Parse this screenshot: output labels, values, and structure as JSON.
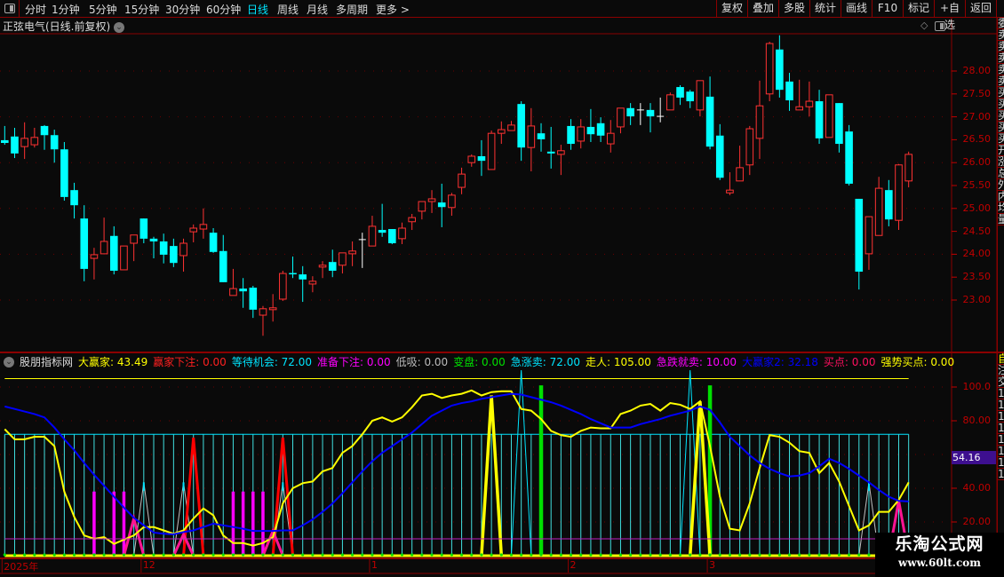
{
  "topbar": {
    "tabs": [
      "分时",
      "1分钟",
      "5分钟",
      "15分钟",
      "30分钟",
      "60分钟",
      "日线",
      "周线",
      "月线",
      "多周期",
      "更多 >"
    ],
    "active_tab": "日线",
    "right_buttons": [
      "复权",
      "叠加",
      "多股",
      "统计",
      "画线",
      "F10",
      "标记",
      "+自选",
      "返回"
    ]
  },
  "title": "正弦电气(日线.前复权)",
  "price_axis": {
    "labels": [
      "28.00",
      "27.50",
      "27.00",
      "26.50",
      "26.00",
      "25.50",
      "25.00",
      "24.50",
      "24.00",
      "23.50",
      "23.00"
    ],
    "range": [
      22.0,
      29.0
    ]
  },
  "right_strip": {
    "top": [
      "委",
      "卖",
      "卖",
      "卖",
      "卖",
      "卖",
      "买",
      "买",
      "买",
      "买",
      "买",
      "开",
      "涨",
      "总",
      "外",
      "内",
      "均",
      "量"
    ],
    "bottom": [
      "自",
      "注",
      "交",
      "1",
      "1",
      "1",
      "1",
      "1",
      "1",
      "1",
      "1"
    ]
  },
  "colors": {
    "up": "#ff3232",
    "down": "#00ffff",
    "doji": "#ffffff",
    "yellow": "#ffff00",
    "blue": "#0000ff",
    "magenta": "#ff00ff",
    "green": "#00e000",
    "pink": "#ff1493",
    "red": "#ff0000"
  },
  "candles": [
    [
      26.49,
      26.43,
      26.8,
      26.39
    ],
    [
      26.57,
      26.2,
      26.76,
      26.1
    ],
    [
      26.35,
      26.53,
      26.88,
      26.08
    ],
    [
      26.39,
      26.55,
      26.76,
      26.33
    ],
    [
      26.8,
      26.6,
      26.82,
      26.28
    ],
    [
      26.6,
      26.29,
      26.72,
      26.0
    ],
    [
      26.29,
      25.25,
      26.45,
      25.17
    ],
    [
      25.4,
      25.07,
      25.56,
      24.78
    ],
    [
      24.78,
      23.68,
      25.07,
      23.41
    ],
    [
      23.91,
      23.99,
      24.14,
      23.45
    ],
    [
      24.01,
      24.28,
      24.8,
      24.0
    ],
    [
      24.4,
      23.64,
      24.61,
      23.56
    ],
    [
      23.66,
      24.18,
      24.18,
      23.66
    ],
    [
      24.24,
      24.42,
      24.42,
      23.85
    ],
    [
      24.78,
      24.34,
      24.78,
      24.24
    ],
    [
      24.34,
      24.28,
      24.38,
      23.91
    ],
    [
      24.28,
      23.99,
      24.45,
      23.8
    ],
    [
      24.18,
      23.81,
      24.34,
      23.72
    ],
    [
      23.97,
      24.24,
      24.34,
      23.62
    ],
    [
      24.49,
      24.57,
      24.65,
      24.26
    ],
    [
      24.55,
      24.65,
      25.0,
      24.34
    ],
    [
      24.47,
      24.05,
      24.57,
      24.03
    ],
    [
      24.07,
      23.39,
      24.42,
      23.39
    ],
    [
      23.1,
      23.25,
      23.68,
      23.1
    ],
    [
      23.25,
      23.19,
      23.48,
      22.83
    ],
    [
      23.27,
      22.79,
      23.31,
      22.61
    ],
    [
      22.67,
      22.81,
      22.87,
      22.22
    ],
    [
      22.79,
      22.83,
      23.13,
      22.53
    ],
    [
      23.02,
      23.58,
      23.64,
      22.98
    ],
    [
      23.59,
      23.57,
      23.95,
      23.48
    ],
    [
      23.56,
      23.45,
      23.74,
      22.96
    ],
    [
      23.35,
      23.41,
      23.52,
      23.17
    ],
    [
      23.72,
      23.76,
      23.85,
      23.48
    ],
    [
      23.83,
      23.64,
      24.1,
      23.5
    ],
    [
      23.76,
      24.03,
      24.03,
      23.58
    ],
    [
      24.01,
      24.07,
      24.28,
      23.74
    ],
    [
      24.32,
      24.32,
      24.47,
      23.7
    ],
    [
      24.18,
      24.61,
      24.84,
      24.18
    ],
    [
      24.53,
      24.47,
      25.1,
      24.38
    ],
    [
      24.55,
      24.24,
      24.55,
      24.22
    ],
    [
      24.34,
      24.57,
      24.69,
      24.22
    ],
    [
      24.71,
      24.8,
      24.88,
      24.53
    ],
    [
      24.94,
      25.15,
      25.15,
      24.76
    ],
    [
      25.15,
      25.21,
      25.4,
      24.9
    ],
    [
      25.13,
      25.03,
      25.54,
      24.59
    ],
    [
      25.02,
      25.29,
      25.34,
      24.84
    ],
    [
      25.46,
      25.75,
      25.89,
      25.31
    ],
    [
      26.0,
      26.14,
      26.18,
      25.91
    ],
    [
      26.14,
      26.04,
      26.49,
      25.71
    ],
    [
      25.85,
      26.64,
      26.7,
      25.85
    ],
    [
      26.64,
      26.72,
      26.9,
      26.41
    ],
    [
      26.7,
      26.82,
      26.91,
      26.7
    ],
    [
      27.28,
      26.33,
      27.34,
      26.04
    ],
    [
      26.33,
      26.8,
      27.19,
      25.81
    ],
    [
      26.64,
      26.51,
      26.86,
      26.24
    ],
    [
      26.24,
      26.2,
      26.78,
      25.87
    ],
    [
      26.18,
      26.26,
      26.39,
      25.73
    ],
    [
      26.8,
      26.41,
      26.95,
      26.28
    ],
    [
      26.47,
      26.78,
      26.95,
      26.31
    ],
    [
      26.78,
      26.62,
      27.17,
      26.45
    ],
    [
      26.86,
      26.59,
      26.99,
      26.45
    ],
    [
      26.41,
      26.64,
      26.93,
      26.22
    ],
    [
      26.78,
      27.19,
      27.19,
      26.64
    ],
    [
      27.19,
      27.01,
      27.3,
      26.82
    ],
    [
      27.15,
      27.15,
      27.3,
      26.82
    ],
    [
      27.15,
      27.01,
      27.3,
      26.66
    ],
    [
      27.01,
      27.01,
      27.42,
      26.88
    ],
    [
      27.15,
      27.48,
      27.53,
      27.15
    ],
    [
      27.65,
      27.42,
      27.69,
      27.26
    ],
    [
      27.55,
      27.34,
      27.59,
      27.19
    ],
    [
      27.15,
      27.79,
      27.79,
      27.01
    ],
    [
      27.44,
      26.35,
      27.88,
      26.29
    ],
    [
      26.59,
      25.67,
      26.84,
      25.62
    ],
    [
      25.34,
      25.4,
      25.79,
      25.29
    ],
    [
      25.6,
      25.89,
      26.37,
      25.6
    ],
    [
      25.95,
      26.74,
      26.8,
      25.73
    ],
    [
      26.53,
      27.24,
      27.79,
      26.08
    ],
    [
      27.5,
      28.6,
      28.64,
      27.34
    ],
    [
      28.47,
      27.59,
      28.78,
      27.42
    ],
    [
      27.77,
      27.36,
      27.96,
      27.13
    ],
    [
      27.15,
      27.22,
      27.81,
      27.15
    ],
    [
      27.22,
      27.34,
      27.77,
      27.01
    ],
    [
      27.34,
      26.53,
      27.59,
      26.41
    ],
    [
      26.55,
      27.48,
      27.48,
      26.55
    ],
    [
      27.3,
      26.41,
      27.3,
      26.22
    ],
    [
      26.68,
      25.54,
      26.82,
      25.5
    ],
    [
      25.21,
      23.62,
      25.21,
      23.23
    ],
    [
      24.01,
      24.82,
      24.82,
      23.66
    ],
    [
      24.41,
      25.44,
      25.69,
      24.41
    ],
    [
      25.4,
      24.76,
      25.62,
      24.61
    ],
    [
      24.74,
      25.95,
      25.97,
      24.53
    ],
    [
      25.6,
      26.18,
      26.24,
      25.46
    ]
  ],
  "indicator": {
    "name": "股朋指标网",
    "items": [
      {
        "label": "大赢家: ",
        "value": "43.49",
        "color": "#ffff00"
      },
      {
        "label": "赢家下注: ",
        "value": "0.00",
        "color": "#ff2020"
      },
      {
        "label": "等待机会: ",
        "value": "72.00",
        "color": "#00e5ff"
      },
      {
        "label": "准备下注: ",
        "value": "0.00",
        "color": "#ff00ff"
      },
      {
        "label": "低吸: ",
        "value": "0.00",
        "color": "#bbbbbb"
      },
      {
        "label": "变盘: ",
        "value": "0.00",
        "color": "#00e000"
      },
      {
        "label": "急涨卖: ",
        "value": "72.00",
        "color": "#00e5ff"
      },
      {
        "label": "走人: ",
        "value": "105.00",
        "color": "#ffff00"
      },
      {
        "label": "急跌就卖: ",
        "value": "10.00",
        "color": "#ff00ff"
      },
      {
        "label": "大赢家2: ",
        "value": "32.18",
        "color": "#0000ff"
      },
      {
        "label": "买点: ",
        "value": "0.00",
        "color": "#ff1060"
      },
      {
        "label": "强势买点: ",
        "value": "0.00",
        "color": "#ffff00"
      }
    ],
    "axis_labels": [
      "100.0",
      "80.00",
      "40.00",
      "20.00"
    ],
    "current_value": "54.16",
    "range": [
      0,
      110
    ],
    "wait_level": 72,
    "exit_level": 105,
    "drop_sell_level": 10,
    "yellow_line": [
      75,
      69,
      69,
      70.5,
      70.5,
      65,
      38,
      23,
      12,
      10,
      11,
      7,
      9.5,
      12,
      17,
      17,
      15,
      13,
      15,
      22,
      28,
      24,
      12,
      7.5,
      7.5,
      6,
      7.5,
      11,
      31,
      40,
      43,
      44,
      50,
      52,
      61,
      65,
      72,
      80,
      82,
      79.5,
      82,
      88,
      95,
      96,
      93.5,
      95,
      96,
      98,
      95,
      97,
      97.5,
      97.5,
      87,
      86,
      81,
      74,
      71.5,
      70.5,
      74,
      76,
      75.5,
      75.5,
      84,
      86,
      89,
      90,
      86,
      90.5,
      89.5,
      87,
      91.5,
      65,
      35,
      16,
      15,
      31,
      52,
      71.5,
      70.5,
      67,
      62,
      61,
      49,
      55,
      44,
      29.5,
      15,
      18,
      26,
      26,
      33,
      43.49
    ],
    "blue_line": [
      88.5,
      87,
      85.5,
      84,
      82,
      76,
      69,
      62.5,
      55,
      48,
      41.5,
      35,
      28.5,
      22.5,
      18,
      13.7,
      13,
      12.7,
      14,
      15,
      17,
      19,
      18,
      17,
      16,
      14.7,
      14.7,
      14.7,
      15,
      15,
      18,
      21.5,
      26,
      31,
      37,
      43.5,
      50,
      56,
      61,
      65,
      69,
      73,
      78,
      83,
      86,
      89,
      90.5,
      91.5,
      93,
      94,
      95,
      96,
      95.5,
      94,
      92.5,
      91,
      89,
      86.5,
      84,
      81,
      78.5,
      76,
      76,
      76,
      78,
      79.5,
      81,
      83,
      84.5,
      86,
      88.5,
      86.5,
      79,
      70.5,
      65,
      59.5,
      55,
      51.5,
      49,
      47,
      47.5,
      49,
      53,
      57.5,
      55,
      51.5,
      47.5,
      43.5,
      39,
      35,
      32.5,
      32.18
    ],
    "prepare_bars": [
      {
        "bar": 10,
        "value": 38
      },
      {
        "bar": 12,
        "value": 38
      },
      {
        "bar": 13,
        "value": 38
      },
      {
        "bar": 24,
        "value": 38
      },
      {
        "bar": 25,
        "value": 38
      },
      {
        "bar": 26,
        "value": 38
      },
      {
        "bar": 27,
        "value": 38
      }
    ],
    "winner_bets": [
      {
        "bar": 20,
        "value": 70
      },
      {
        "bar": 29,
        "value": 70
      }
    ],
    "buy_points": [
      {
        "bar": 14,
        "value": 22
      },
      {
        "bar": 19,
        "value": 12.6
      },
      {
        "bar": 28,
        "value": 14.7
      },
      {
        "bar": 91,
        "value": 32.6
      }
    ],
    "dip_buys": [
      {
        "bar": 15,
        "value": 43.5
      },
      {
        "bar": 19,
        "value": 43.5
      },
      {
        "bar": 29,
        "value": 43.5
      },
      {
        "bar": 88,
        "value": 43.5
      }
    ],
    "rapid_sells": [
      {
        "bar": 53,
        "value": 110
      },
      {
        "bar": 70,
        "value": 110
      }
    ],
    "strong_buys": [
      {
        "bar": 50,
        "value": 95
      },
      {
        "bar": 71,
        "value": 91.5
      }
    ],
    "change_bars": [
      {
        "bar": 55,
        "value": 101
      },
      {
        "bar": 72,
        "value": 101
      }
    ]
  },
  "time_axis": [
    {
      "bar": 1,
      "label": "2025年"
    },
    {
      "bar": 15,
      "label": "12"
    },
    {
      "bar": 38,
      "label": "1"
    },
    {
      "bar": 58,
      "label": "2"
    },
    {
      "bar": 72,
      "label": "3"
    }
  ],
  "watermark": {
    "name": "乐淘公式网",
    "url": "www.60lt.com"
  }
}
